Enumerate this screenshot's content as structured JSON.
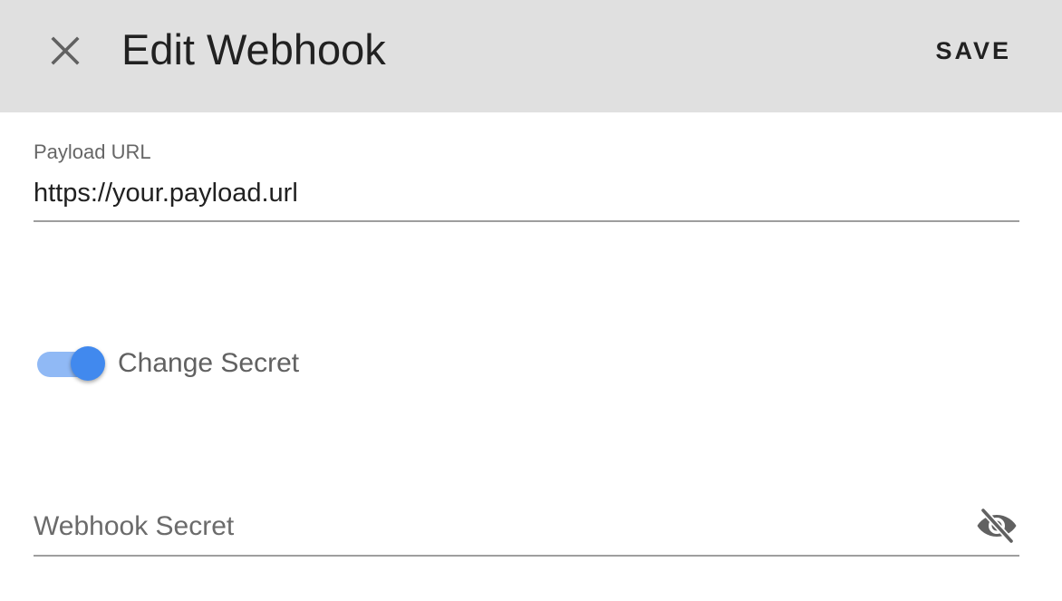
{
  "header": {
    "title": "Edit Webhook",
    "close_icon": "close-icon",
    "save_label": "SAVE",
    "background": "#e0e0e0"
  },
  "payload_url": {
    "label": "Payload URL",
    "value": "https://your.payload.url"
  },
  "change_secret": {
    "label": "Change Secret",
    "checked": true,
    "accent": "#4189ee"
  },
  "webhook_secret": {
    "placeholder": "Webhook Secret",
    "value": "",
    "visibility_icon": "visibility-off-icon"
  }
}
